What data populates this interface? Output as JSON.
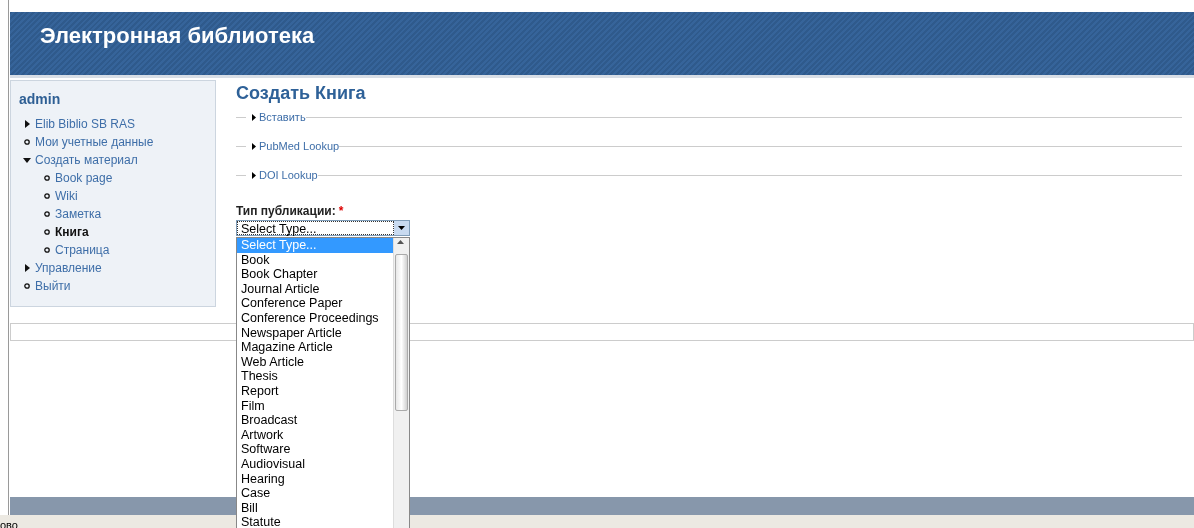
{
  "header": {
    "title": "Электронная библиотека"
  },
  "sidebar": {
    "title": "admin",
    "items": [
      {
        "label": "Elib Biblio SB RAS",
        "kind": "branch",
        "expanded": false,
        "selected": false
      },
      {
        "label": "Мои учетные данные",
        "kind": "leaf",
        "selected": false
      },
      {
        "label": "Создать материал",
        "kind": "branch",
        "expanded": true,
        "selected": false,
        "children": [
          {
            "label": "Book page",
            "kind": "leaf",
            "selected": false
          },
          {
            "label": "Wiki",
            "kind": "leaf",
            "selected": false
          },
          {
            "label": "Заметка",
            "kind": "leaf",
            "selected": false
          },
          {
            "label": "Книга",
            "kind": "leaf",
            "selected": true
          },
          {
            "label": "Страница",
            "kind": "leaf",
            "selected": false
          }
        ]
      },
      {
        "label": "Управление",
        "kind": "branch",
        "expanded": false,
        "selected": false
      },
      {
        "label": "Выйти",
        "kind": "leaf",
        "selected": false
      }
    ]
  },
  "main": {
    "title": "Создать Книга",
    "fieldsets": [
      {
        "label": "Вставить",
        "expanded": false
      },
      {
        "label": "PubMed Lookup",
        "expanded": false
      },
      {
        "label": "DOI Lookup",
        "expanded": false
      }
    ],
    "type_field": {
      "label": "Тип публикации:",
      "required_mark": "*",
      "value": "Select Type...",
      "open": true,
      "options": [
        {
          "label": "Select Type...",
          "selected": true
        },
        {
          "label": "Book",
          "selected": false
        },
        {
          "label": "Book Chapter",
          "selected": false
        },
        {
          "label": "Journal Article",
          "selected": false
        },
        {
          "label": "Conference Paper",
          "selected": false
        },
        {
          "label": "Conference Proceedings",
          "selected": false
        },
        {
          "label": "Newspaper Article",
          "selected": false
        },
        {
          "label": "Magazine Article",
          "selected": false
        },
        {
          "label": "Web Article",
          "selected": false
        },
        {
          "label": "Thesis",
          "selected": false
        },
        {
          "label": "Report",
          "selected": false
        },
        {
          "label": "Film",
          "selected": false
        },
        {
          "label": "Broadcast",
          "selected": false
        },
        {
          "label": "Artwork",
          "selected": false
        },
        {
          "label": "Software",
          "selected": false
        },
        {
          "label": "Audiovisual",
          "selected": false
        },
        {
          "label": "Hearing",
          "selected": false
        },
        {
          "label": "Case",
          "selected": false
        },
        {
          "label": "Bill",
          "selected": false
        },
        {
          "label": "Statute",
          "selected": false
        }
      ]
    }
  },
  "status_bar": {
    "text": "ово"
  }
}
